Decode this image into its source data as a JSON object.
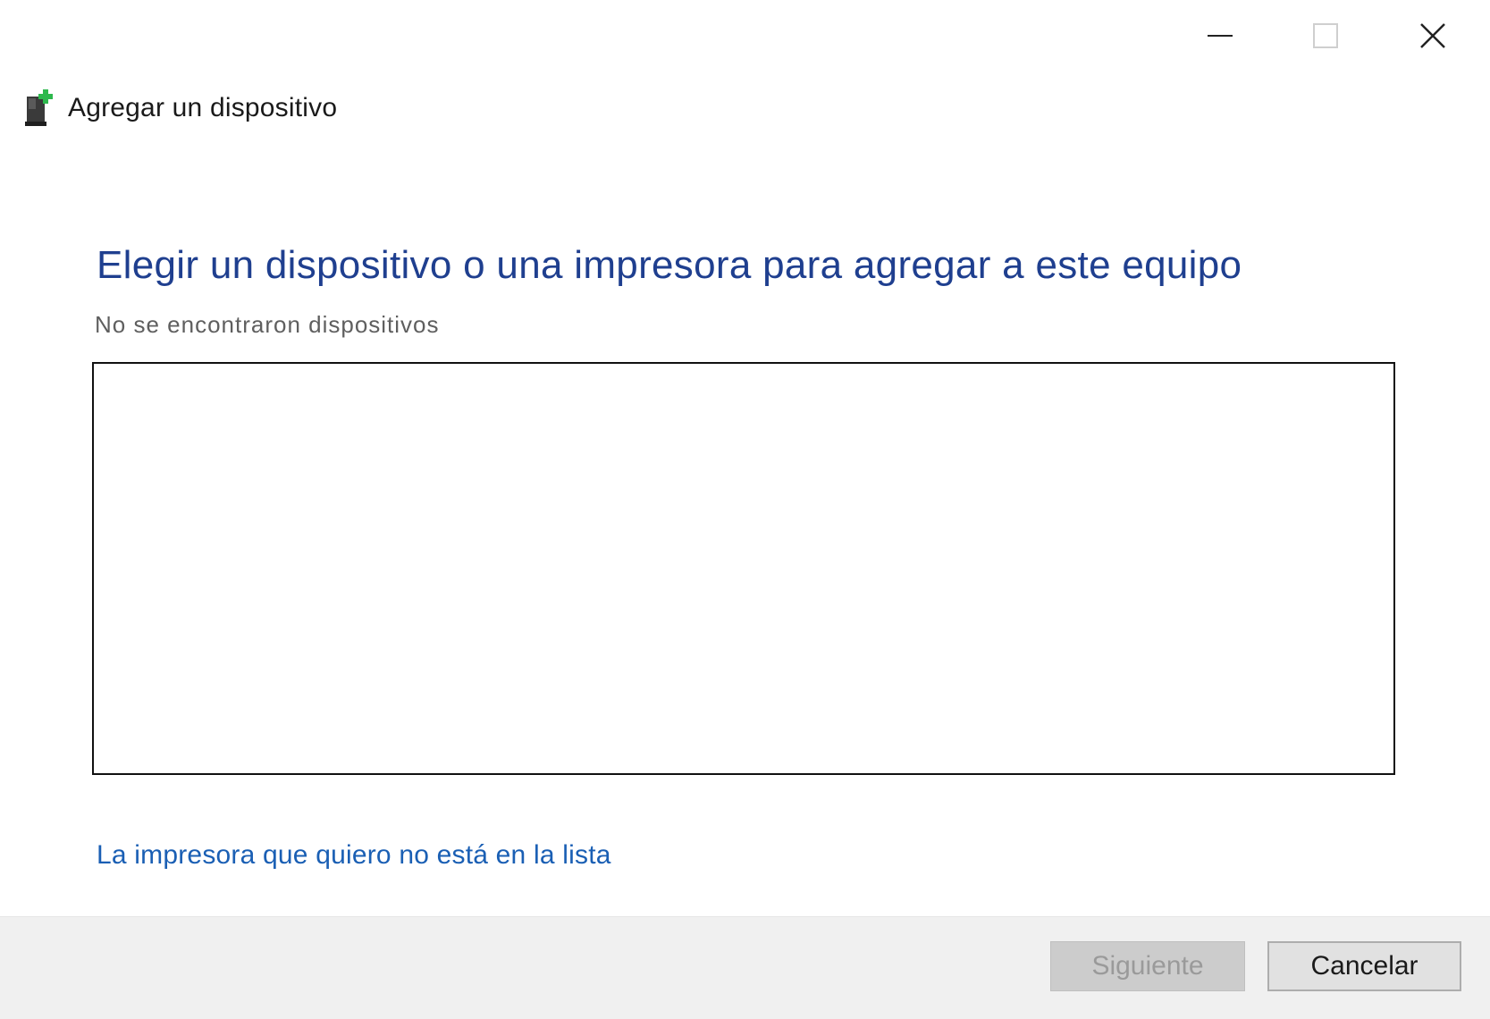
{
  "window": {
    "title": "Agregar un dispositivo",
    "minimize_icon": "minimize-icon",
    "maximize_icon": "maximize-icon",
    "close_icon": "close-icon"
  },
  "main": {
    "heading": "Elegir un dispositivo o una impresora para agregar a este equipo",
    "status": "No se encontraron dispositivos",
    "devices": [],
    "printer_link": "La impresora que quiero no está en la lista"
  },
  "footer": {
    "next_label": "Siguiente",
    "cancel_label": "Cancelar",
    "next_enabled": false
  },
  "colors": {
    "heading": "#1f3f8f",
    "link": "#1a5fb4",
    "footer_bg": "#f0f0f0",
    "icon_plus": "#2db84d"
  }
}
